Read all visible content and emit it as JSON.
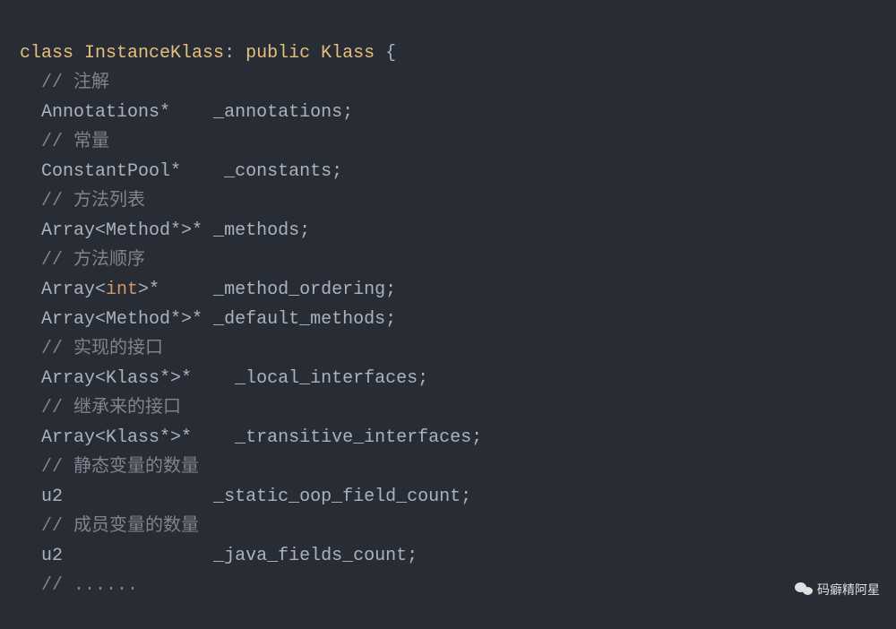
{
  "code": {
    "line1": {
      "kw1": "class",
      "name": "InstanceKlass",
      "colon": ":",
      "kw2": "public",
      "base": "Klass",
      "brace": "{"
    },
    "line2": {
      "slashes": "//",
      "text": "注解"
    },
    "line3": {
      "type": "Annotations*",
      "field": "_annotations;"
    },
    "line4": {
      "slashes": "//",
      "text": "常量"
    },
    "line5": {
      "type": "ConstantPool*",
      "field": "_constants;"
    },
    "line6": {
      "slashes": "//",
      "text": "方法列表"
    },
    "line7": {
      "type": "Array<Method*>*",
      "field": "_methods;"
    },
    "line8": {
      "slashes": "//",
      "text": "方法顺序"
    },
    "line9": {
      "p1": "Array<",
      "kw": "int",
      "p2": ">*",
      "field": "_method_ordering;"
    },
    "line10": {
      "type": "Array<Method*>*",
      "field": "_default_methods;"
    },
    "line11": {
      "slashes": "//",
      "text": "实现的接口"
    },
    "line12": {
      "type": "Array<Klass*>*",
      "field": "_local_interfaces;"
    },
    "line13": {
      "slashes": "//",
      "text": "继承来的接口"
    },
    "line14": {
      "type": "Array<Klass*>*",
      "field": "_transitive_interfaces;"
    },
    "line15": {
      "slashes": "//",
      "text": "静态变量的数量"
    },
    "line16": {
      "type": "u2",
      "field": "_static_oop_field_count;"
    },
    "line17": {
      "slashes": "//",
      "text": "成员变量的数量"
    },
    "line18": {
      "type": "u2",
      "field": "_java_fields_count;"
    },
    "line19": {
      "text": "// ......"
    }
  },
  "watermark": {
    "text": "码癖精阿星"
  }
}
